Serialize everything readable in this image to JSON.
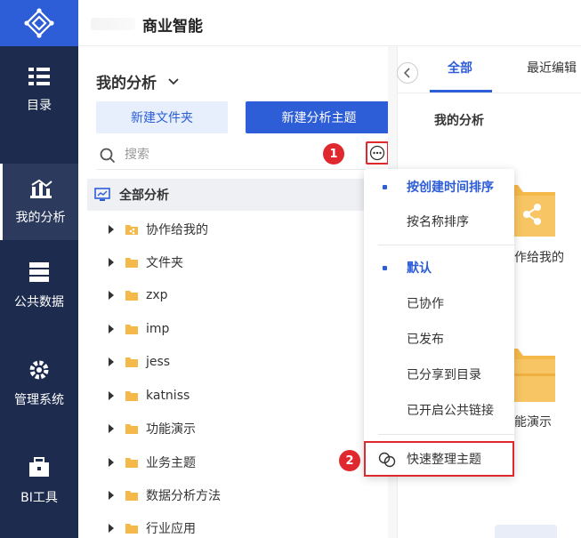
{
  "header": {
    "title": "商业智能"
  },
  "nav": {
    "items": [
      {
        "label": "目录",
        "icon": "catalog-icon"
      },
      {
        "label": "我的分析",
        "icon": "analysis-chart-icon",
        "active": true
      },
      {
        "label": "公共数据",
        "icon": "public-data-icon"
      },
      {
        "label": "管理系统",
        "icon": "gear-icon"
      },
      {
        "label": "BI工具",
        "icon": "toolbox-icon"
      }
    ]
  },
  "panel": {
    "title": "我的分析",
    "new_folder_label": "新建文件夹",
    "new_theme_label": "新建分析主题",
    "search_placeholder": "搜索",
    "tree_root": "全部分析",
    "tree_items": [
      "协作给我的",
      "文件夹",
      "zxp",
      "imp",
      "jess",
      "katniss",
      "功能演示",
      "业务主题",
      "数据分析方法",
      "行业应用"
    ]
  },
  "badges": {
    "step1": "1",
    "step2": "2"
  },
  "right": {
    "tab_all": "全部",
    "tab_recent": "最近编辑",
    "heading": "我的分析",
    "card1_label": "作给我的",
    "card2_label": "能演示"
  },
  "menu": {
    "sort_group": [
      {
        "label": "按创建时间排序",
        "selected": true
      },
      {
        "label": "按名称排序",
        "selected": false
      }
    ],
    "filter_group": [
      {
        "label": "默认",
        "selected": true
      },
      {
        "label": "已协作",
        "selected": false
      },
      {
        "label": "已发布",
        "selected": false
      },
      {
        "label": "已分享到目录",
        "selected": false
      },
      {
        "label": "已开启公共链接",
        "selected": false
      }
    ],
    "quick_label": "快速整理主题"
  },
  "colors": {
    "accent": "#2d5dd7",
    "nav_bg": "#1d2b4f",
    "highlight_red": "#e0292e",
    "folder": "#f5b94a"
  }
}
